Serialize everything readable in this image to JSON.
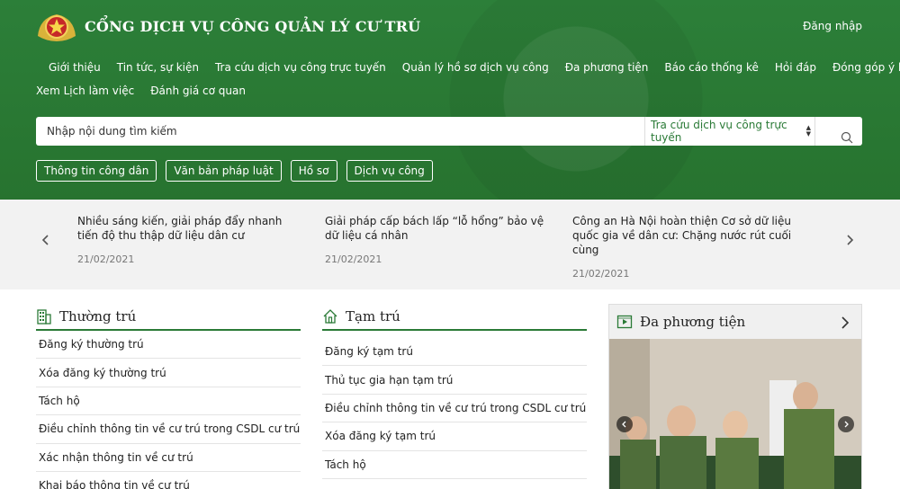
{
  "header": {
    "title": "CỔNG DỊCH VỤ CÔNG QUẢN LÝ CƯ TRÚ",
    "login": "Đăng nhập"
  },
  "nav": {
    "row1": [
      "Giới thiệu",
      "Tin tức, sự kiện",
      "Tra cứu dịch vụ công trực tuyến",
      "Quản lý hồ sơ dịch vụ công",
      "Đa phương tiện",
      "Báo cáo thống kê",
      "Hỏi đáp",
      "Đóng góp ý kiến"
    ],
    "row2": [
      "Xem Lịch làm việc",
      "Đánh giá cơ quan"
    ]
  },
  "search": {
    "placeholder": "Nhập nội dung tìm kiếm",
    "select_value": "Tra cứu dịch vụ công trực tuyến"
  },
  "tags": [
    "Thông tin công dân",
    "Văn bản pháp luật",
    "Hồ sơ",
    "Dịch vụ công"
  ],
  "news": [
    {
      "title": "Nhiều sáng kiến, giải pháp đẩy nhanh tiến độ thu thập dữ liệu dân cư",
      "date": "21/02/2021"
    },
    {
      "title": "Giải pháp cấp bách lấp “lỗ hổng” bảo vệ dữ liệu cá nhân",
      "date": "21/02/2021"
    },
    {
      "title": "Công an Hà Nội hoàn thiện Cơ sở dữ liệu quốc gia về dân cư: Chặng nước rút cuối cùng",
      "date": "21/02/2021"
    }
  ],
  "thuong_tru": {
    "title": "Thường trú",
    "items": [
      "Đăng ký thường trú",
      "Xóa đăng ký thường trú",
      "Tách hộ",
      "Điều chỉnh thông tin về cư trú trong CSDL cư trú",
      "Xác nhận thông tin về cư trú",
      "Khai báo thông tin về cư trú"
    ]
  },
  "tam_tru": {
    "title": "Tạm trú",
    "items": [
      "Đăng ký tạm trú",
      "Thủ tục gia hạn tạm trú",
      "Điều chỉnh thông tin về cư trú trong CSDL cư trú",
      "Xóa đăng ký tạm trú",
      "Tách hộ"
    ]
  },
  "media": {
    "title": "Đa phương tiện"
  },
  "colors": {
    "brand_green": "#2a7a36"
  }
}
